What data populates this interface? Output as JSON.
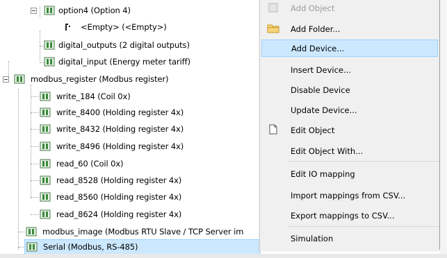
{
  "tree": {
    "rows": [
      {
        "label": "option4 (Option 4)"
      },
      {
        "label": "<Empty> (<Empty>)"
      },
      {
        "label": "digital_outputs (2 digital outputs)"
      },
      {
        "label": "digital_input (Energy meter tariff)"
      },
      {
        "label": "modbus_register (Modbus register)"
      },
      {
        "label": "write_184 (Coil 0x)"
      },
      {
        "label": "write_8400 (Holding register 4x)"
      },
      {
        "label": "write_8432 (Holding register 4x)"
      },
      {
        "label": "write_8496 (Holding register 4x)"
      },
      {
        "label": "read_60 (Coil 0x)"
      },
      {
        "label": "read_8528 (Holding register 4x)"
      },
      {
        "label": "read_8560 (Holding register 4x)"
      },
      {
        "label": "read_8624 (Holding register 4x)"
      },
      {
        "label": "modbus_image (Modbus RTU Slave / TCP Server im"
      },
      {
        "label": "Serial (Modbus, RS-485)"
      }
    ]
  },
  "context_menu": {
    "items": [
      {
        "label": "Add Object",
        "icon": "add-object-icon",
        "disabled": true
      },
      {
        "label": "Add Folder...",
        "icon": "folder-icon"
      },
      {
        "label": "Add Device...",
        "highlighted": true
      },
      {
        "label": "Insert Device..."
      },
      {
        "label": "Disable Device"
      },
      {
        "label": "Update Device..."
      },
      {
        "label": "Edit Object",
        "icon": "edit-object-icon"
      },
      {
        "label": "Edit Object With..."
      },
      {
        "label": "Edit IO mapping"
      },
      {
        "label": "Import mappings from CSV..."
      },
      {
        "label": "Export mappings to CSV..."
      },
      {
        "label": "Simulation"
      }
    ]
  },
  "colors": {
    "selection": "#cce8ff",
    "selection_border": "#99d1ff",
    "menu_bg": "#f0f0f0",
    "device_icon": "#3a8a3a"
  }
}
